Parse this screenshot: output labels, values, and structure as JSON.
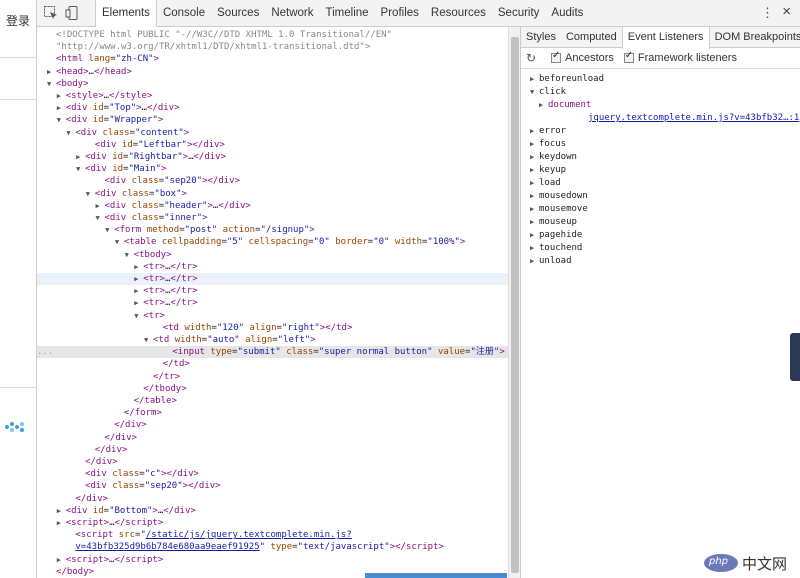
{
  "page": {
    "login_label": "登录"
  },
  "toolbar": {
    "tabs": [
      "Elements",
      "Console",
      "Sources",
      "Network",
      "Timeline",
      "Profiles",
      "Resources",
      "Security",
      "Audits"
    ],
    "active_tab": "Elements"
  },
  "dom": {
    "lines": [
      {
        "html": "<span class=\"c\">&lt;!DOCTYPE html PUBLIC \"-//W3C//DTD XHTML 1.0 Transitional//EN\"</span>"
      },
      {
        "html": "<span class=\"c\">\"http://www.w3.org/TR/xhtml1/DTD/xhtml1-transitional.dtd\"&gt;</span>"
      },
      {
        "html": "<span class=\"t\">&lt;html</span> <span class=\"a\">lang</span>=<span class=\"v\">\"zh-CN\"</span><span class=\"t\">&gt;</span>"
      },
      {
        "html": "<span class=\"arrow\">▶</span><span class=\"t\">&lt;head&gt;</span>…<span class=\"t\">&lt;/head&gt;</span>"
      },
      {
        "html": "<span class=\"arrow\">▼</span><span class=\"t\">&lt;body&gt;</span>"
      },
      {
        "html": "<span class=\"arrow\">▶</span><span class=\"t\">&lt;style&gt;</span>…<span class=\"t\">&lt;/style&gt;</span>"
      },
      {
        "html": "<span class=\"arrow\">▶</span><span class=\"t\">&lt;div</span> <span class=\"a\">id</span>=<span class=\"v\">\"Top\"</span><span class=\"t\">&gt;</span>…<span class=\"t\">&lt;/div&gt;</span>"
      },
      {
        "html": "<span class=\"arrow\">▼</span><span class=\"t\">&lt;div</span> <span class=\"a\">id</span>=<span class=\"v\">\"Wrapper\"</span><span class=\"t\">&gt;</span>"
      },
      {
        "html": "<span class=\"arrow\">▼</span><span class=\"t\">&lt;div</span> <span class=\"a\">class</span>=<span class=\"v\">\"content\"</span><span class=\"t\">&gt;</span>"
      },
      {
        "html": "<span class=\"t\">&lt;div</span> <span class=\"a\">id</span>=<span class=\"v\">\"Leftbar\"</span><span class=\"t\">&gt;&lt;/div&gt;</span>"
      },
      {
        "html": "<span class=\"arrow\">▶</span><span class=\"t\">&lt;div</span> <span class=\"a\">id</span>=<span class=\"v\">\"Rightbar\"</span><span class=\"t\">&gt;</span>…<span class=\"t\">&lt;/div&gt;</span>"
      },
      {
        "html": "<span class=\"arrow\">▼</span><span class=\"t\">&lt;div</span> <span class=\"a\">id</span>=<span class=\"v\">\"Main\"</span><span class=\"t\">&gt;</span>"
      },
      {
        "html": "<span class=\"t\">&lt;div</span> <span class=\"a\">class</span>=<span class=\"v\">\"sep20\"</span><span class=\"t\">&gt;&lt;/div&gt;</span>"
      },
      {
        "html": "<span class=\"arrow\">▼</span><span class=\"t\">&lt;div</span> <span class=\"a\">class</span>=<span class=\"v\">\"box\"</span><span class=\"t\">&gt;</span>"
      },
      {
        "html": "<span class=\"arrow\">▶</span><span class=\"t\">&lt;div</span> <span class=\"a\">class</span>=<span class=\"v\">\"header\"</span><span class=\"t\">&gt;</span>…<span class=\"t\">&lt;/div&gt;</span>"
      },
      {
        "html": "<span class=\"arrow\">▼</span><span class=\"t\">&lt;div</span> <span class=\"a\">class</span>=<span class=\"v\">\"inner\"</span><span class=\"t\">&gt;</span>"
      },
      {
        "html": "<span class=\"arrow\">▼</span><span class=\"t\">&lt;form</span> <span class=\"a\">method</span>=<span class=\"v\">\"post\"</span> <span class=\"a\">action</span>=<span class=\"v\">\"/signup\"</span><span class=\"t\">&gt;</span>"
      },
      {
        "html": "<span class=\"arrow\">▼</span><span class=\"t\">&lt;table</span> <span class=\"a\">cellpadding</span>=<span class=\"v\">\"5\"</span> <span class=\"a\">cellspacing</span>=<span class=\"v\">\"0\"</span> <span class=\"a\">border</span>=<span class=\"v\">\"0\"</span> <span class=\"a\">width</span>=<span class=\"v\">\"100%\"</span><span class=\"t\">&gt;</span>"
      },
      {
        "html": "<span class=\"arrow\">▼</span><span class=\"t\">&lt;tbody&gt;</span>"
      },
      {
        "html": "<span class=\"arrow\">▶</span><span class=\"t\">&lt;tr&gt;</span>…<span class=\"t\">&lt;/tr&gt;</span>"
      },
      {
        "html": "<span class=\"arrow\">▶</span><span class=\"t\">&lt;tr&gt;</span>…<span class=\"t\">&lt;/tr&gt;</span>"
      },
      {
        "html": "<span class=\"arrow\">▶</span><span class=\"t\">&lt;tr&gt;</span>…<span class=\"t\">&lt;/tr&gt;</span>"
      },
      {
        "html": "<span class=\"arrow\">▶</span><span class=\"t\">&lt;tr&gt;</span>…<span class=\"t\">&lt;/tr&gt;</span>"
      },
      {
        "html": "<span class=\"arrow\">▼</span><span class=\"t\">&lt;tr&gt;</span>"
      },
      {
        "html": "<span class=\"t\">&lt;td</span> <span class=\"a\">width</span>=<span class=\"v\">\"120\"</span> <span class=\"a\">align</span>=<span class=\"v\">\"right\"</span><span class=\"t\">&gt;&lt;/td&gt;</span>"
      },
      {
        "html": "<span class=\"arrow\">▼</span><span class=\"t\">&lt;td</span> <span class=\"a\">width</span>=<span class=\"v\">\"auto\"</span> <span class=\"a\">align</span>=<span class=\"v\">\"left\"</span><span class=\"t\">&gt;</span>"
      },
      {
        "html": "<span class=\"t\">&lt;input</span> <span class=\"a\">type</span>=<span class=\"v\">\"submit\"</span> <span class=\"a\">class</span>=<span class=\"v\">\"super normal button\"</span> <span class=\"a\">value</span>=<span class=\"v\">\"注册\"</span><span class=\"t\">&gt;</span>"
      },
      {
        "html": "<span class=\"t\">&lt;/td&gt;</span>"
      },
      {
        "html": "<span class=\"t\">&lt;/tr&gt;</span>"
      },
      {
        "html": "<span class=\"t\">&lt;/tbody&gt;</span>"
      },
      {
        "html": "<span class=\"t\">&lt;/table&gt;</span>"
      },
      {
        "html": "<span class=\"t\">&lt;/form&gt;</span>"
      },
      {
        "html": "<span class=\"t\">&lt;/div&gt;</span>"
      },
      {
        "html": "<span class=\"t\">&lt;/div&gt;</span>"
      },
      {
        "html": "<span class=\"t\">&lt;/div&gt;</span>"
      },
      {
        "html": "<span class=\"t\">&lt;/div&gt;</span>"
      },
      {
        "html": "<span class=\"t\">&lt;div</span> <span class=\"a\">class</span>=<span class=\"v\">\"c\"</span><span class=\"t\">&gt;&lt;/div&gt;</span>"
      },
      {
        "html": "<span class=\"t\">&lt;div</span> <span class=\"a\">class</span>=<span class=\"v\">\"sep20\"</span><span class=\"t\">&gt;&lt;/div&gt;</span>"
      },
      {
        "html": "<span class=\"t\">&lt;/div&gt;</span>"
      },
      {
        "html": "<span class=\"arrow\">▶</span><span class=\"t\">&lt;div</span> <span class=\"a\">id</span>=<span class=\"v\">\"Bottom\"</span><span class=\"t\">&gt;</span>…<span class=\"t\">&lt;/div&gt;</span>"
      },
      {
        "html": "<span class=\"arrow\">▶</span><span class=\"t\">&lt;script&gt;</span>…<span class=\"t\">&lt;/script&gt;</span>"
      },
      {
        "html": "<span class=\"t\">&lt;script</span> <span class=\"a\">src</span>=<span class=\"v\">\"</span><span class=\"lk\">/static/js/jquery.textcomplete.min.js?</span>"
      },
      {
        "html": "<span class=\"lk\">v=43bfb325d9b6b784e680aa9eaef91925</span><span class=\"v\">\"</span> <span class=\"a\">type</span>=<span class=\"v\">\"text/javascript\"</span><span class=\"t\">&gt;&lt;/script&gt;</span>"
      },
      {
        "html": "<span class=\"arrow\">▶</span><span class=\"t\">&lt;script&gt;</span>…<span class=\"t\">&lt;/script&gt;</span>"
      },
      {
        "html": "<span class=\"t\">&lt;/body&gt;</span>"
      }
    ]
  },
  "sidebar": {
    "tabs": [
      "Styles",
      "Computed",
      "Event Listeners",
      "DOM Breakpoints"
    ],
    "active_tab": "Event Listeners",
    "options": {
      "ancestors": "Ancestors",
      "framework": "Framework listeners"
    },
    "events": [
      "beforeunload",
      "click",
      "error",
      "focus",
      "keydown",
      "keyup",
      "load",
      "mousedown",
      "mousemove",
      "mouseup",
      "pagehide",
      "touchend",
      "unload"
    ],
    "click_child": "document",
    "click_source": "jquery.textcomplete.min.js?v=43bfb32…:1"
  },
  "watermark": {
    "logo": "php",
    "text": "中文网"
  }
}
